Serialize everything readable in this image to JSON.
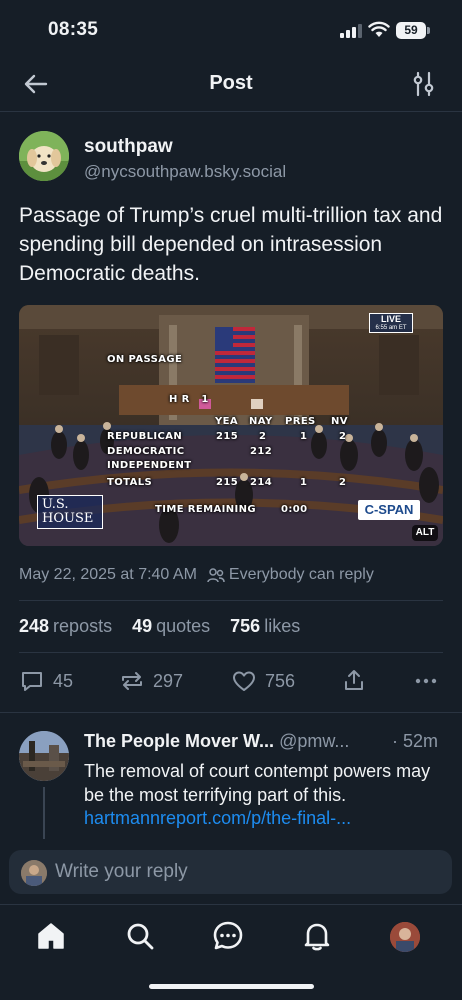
{
  "status_bar": {
    "time": "08:35",
    "battery": "59"
  },
  "header": {
    "title": "Post",
    "back_icon": "arrow-left-icon",
    "filter_icon": "sliders-icon"
  },
  "post": {
    "author_name": "southpaw",
    "author_handle": "@nycsouthpaw.bsky.social",
    "text": "Passage of Trump’s cruel multi-trillion tax and spending bill depended on intrasession Democratic deaths.",
    "media": {
      "live_label": "LIVE",
      "live_time": "6:55 am ET",
      "on_passage": "ON PASSAGE",
      "bill": "H R   1",
      "columns": [
        "YEA",
        "NAY",
        "PRES",
        "NV"
      ],
      "rows": [
        {
          "label": "REPUBLICAN",
          "yea": "215",
          "nay": "2",
          "pres": "1",
          "nv": "2"
        },
        {
          "label": "DEMOCRATIC",
          "yea": "",
          "nay": "212",
          "pres": "",
          "nv": ""
        },
        {
          "label": "INDEPENDENT",
          "yea": "",
          "nay": "",
          "pres": "",
          "nv": ""
        },
        {
          "label": "TOTALS",
          "yea": "215",
          "nay": "214",
          "pres": "1",
          "nv": "2"
        }
      ],
      "time_remaining_label": "TIME REMAINING",
      "time_remaining": "0:00",
      "house_logo": "U.S. HOUSE",
      "cspan_logo": "C-SPAN",
      "alt_badge": "ALT"
    },
    "timestamp": "May 22, 2025 at 7:40 AM",
    "reply_setting": "Everybody can reply",
    "stats": {
      "reposts_count": "248",
      "reposts_label": "reposts",
      "quotes_count": "49",
      "quotes_label": "quotes",
      "likes_count": "756",
      "likes_label": "likes"
    },
    "actions": {
      "reply_count": "45",
      "repost_count": "297",
      "like_count": "756"
    }
  },
  "reply": {
    "author_name": "The People Mover W...",
    "author_handle": "@pmw...",
    "time": "· 52m",
    "text": "The removal of court contempt powers may be the most terrifying part of this.",
    "link": "hartmannreport.com/p/the-final-..."
  },
  "composer": {
    "placeholder": "Write your reply"
  },
  "tabbar": {
    "items": [
      "home-icon",
      "search-icon",
      "chat-icon",
      "bell-icon",
      "profile-avatar"
    ]
  }
}
